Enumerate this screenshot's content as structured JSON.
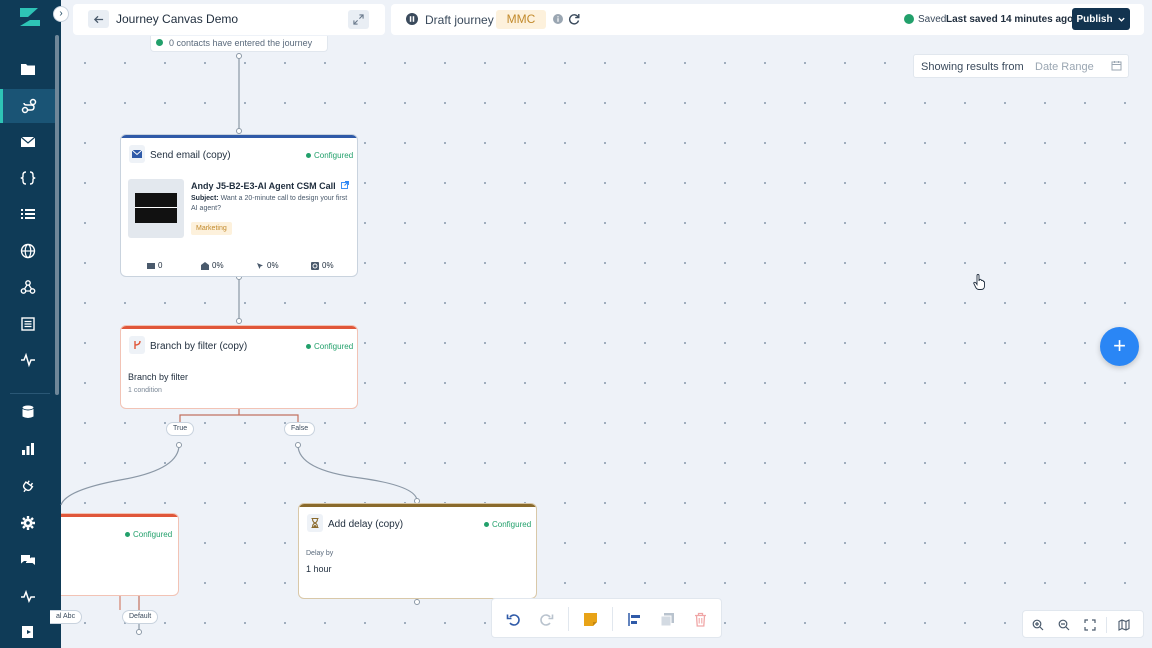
{
  "header": {
    "journey_title": "Journey Canvas Demo",
    "status_label": "Draft journey",
    "badge": "MMC",
    "saved_label": "Saved",
    "saved_time": "Last saved 14 minutes ago",
    "publish_label": "Publish"
  },
  "results": {
    "label": "Showing results from",
    "date_placeholder": "Date Range"
  },
  "canvas": {
    "entry_text": "0 contacts have entered the journey",
    "email_node": {
      "title": "Send email (copy)",
      "status": "Configured",
      "email_name": "Andy J5-B2-E3-AI Agent CSM Call",
      "subject_label": "Subject:",
      "subject": "Want a 20-minute call to design your first AI agent?",
      "tag": "Marketing",
      "stats": {
        "sent": "0",
        "opened": "0%",
        "clicked": "0%",
        "unsubscribed": "0%"
      }
    },
    "branch_node": {
      "title": "Branch by filter (copy)",
      "status": "Configured",
      "label": "Branch by filter",
      "condition": "1 condition",
      "true_label": "True",
      "false_label": "False"
    },
    "left_node": {
      "status": "Configured",
      "edge_left": "al Abc",
      "edge_default": "Default"
    },
    "delay_node": {
      "title": "Add delay (copy)",
      "status": "Configured",
      "delay_by_label": "Delay by",
      "delay_value": "1 hour"
    }
  },
  "colors": {
    "sidebar": "#0f3b57",
    "accent": "#2ec4b6",
    "email_bar": "#2f5aa8",
    "branch_bar": "#e0573a",
    "delay_bar": "#8a6a2c",
    "configured": "#22a06b",
    "fab": "#2a86f5",
    "publish": "#12334f"
  },
  "sidebar": {
    "icons": [
      "folder-icon",
      "journey-icon",
      "mail-icon",
      "code-braces-icon",
      "list-icon",
      "globe-icon",
      "webhook-icon",
      "form-icon",
      "activity-icon",
      "database-icon",
      "bar-chart-icon",
      "plug-icon",
      "gear-icon",
      "chat-icon",
      "pulse-icon",
      "exit-icon"
    ]
  }
}
